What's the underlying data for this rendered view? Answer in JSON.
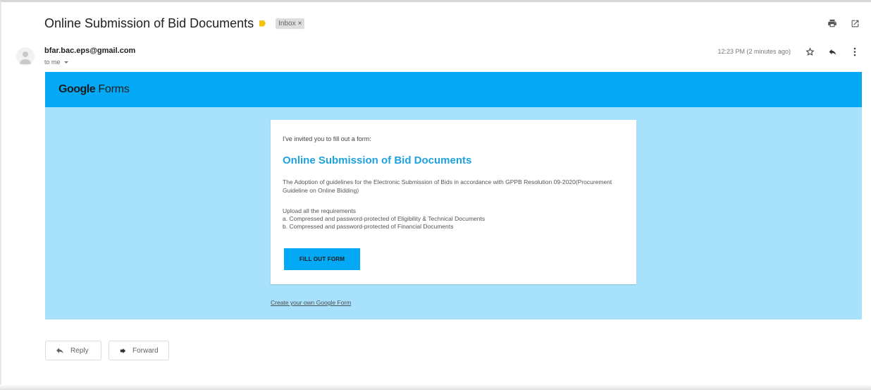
{
  "email": {
    "subject": "Online Submission of Bid Documents",
    "label": "Inbox",
    "label_remove": "×",
    "sender": "bfar.bac.eps@gmail.com",
    "recipient": "to me",
    "time": "12:23 PM (2 minutes ago)"
  },
  "icons": {
    "print": "print-icon",
    "open_new_window": "open-in-new-window-icon",
    "star": "star-icon",
    "reply": "reply-icon",
    "more": "more-vertical-icon",
    "importance": "importance-marker-icon",
    "avatar": "person-avatar-icon",
    "forward": "forward-icon"
  },
  "form_email": {
    "brand": "Google",
    "brand_suffix": "Forms",
    "invite_text": "I've invited you to fill out a form:",
    "form_title": "Online Submission of Bid Documents",
    "description": "The Adoption of guidelines for the Electronic Submission of Bids in accordance with GPPB Resolution 09-2020(Procurement Guideline on Online Bidding)",
    "requirements_heading": "Upload all the requirements",
    "requirements": [
      "a. Compressed and password-protected of Eligibility & Technical Documents",
      "b. Compressed and password-protected of Financial Documents"
    ],
    "button_label": "FILL OUT FORM",
    "create_link": "Create your own Google Form"
  },
  "actions": {
    "reply": "Reply",
    "forward": "Forward"
  },
  "colors": {
    "forms_blue": "#03a9f4",
    "body_light_blue": "#a8e1fb",
    "title_blue": "#1ea1dc",
    "importance_yellow": "#f4c20d"
  }
}
